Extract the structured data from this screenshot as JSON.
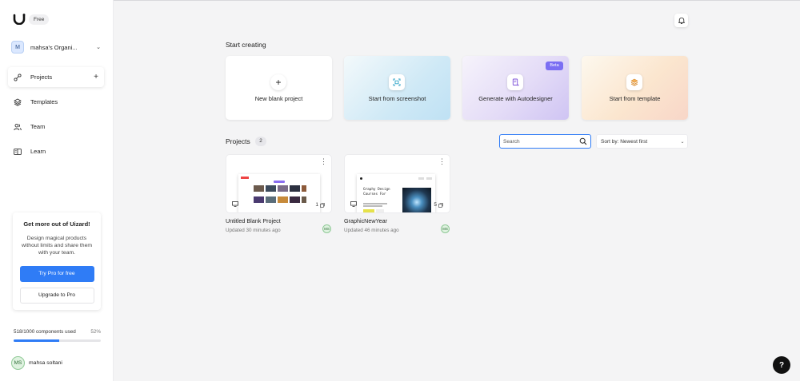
{
  "sidebar": {
    "plan_badge": "Free",
    "org": {
      "initial": "M",
      "name": "mahsa's Organi..."
    },
    "nav": [
      {
        "label": "Projects",
        "icon": "projects-icon"
      },
      {
        "label": "Templates",
        "icon": "layers-icon"
      },
      {
        "label": "Team",
        "icon": "team-icon"
      },
      {
        "label": "Learn",
        "icon": "book-icon"
      }
    ],
    "promo": {
      "title": "Get more out of Uizard!",
      "text": "Design magical products without limits and share them with your team.",
      "primary_button": "Try Pro for free",
      "secondary_button": "Upgrade to Pro"
    },
    "usage": {
      "label": "518/1000 components used",
      "percent_text": "52%",
      "fraction": 0.52
    },
    "user": {
      "initials": "MS",
      "name": "mahsa soltani"
    }
  },
  "main": {
    "start_title": "Start creating",
    "start_cards": [
      {
        "label": "New blank project",
        "icon": "plus-icon"
      },
      {
        "label": "Start from screenshot",
        "icon": "screenshot-scan-icon"
      },
      {
        "label": "Generate with Autodesigner",
        "icon": "autodesigner-icon",
        "badge": "Beta"
      },
      {
        "label": "Start from template",
        "icon": "template-stack-icon"
      }
    ],
    "projects_title": "Projects",
    "projects_count": "2",
    "search_placeholder": "Search",
    "sort_label": "Sort by: Newest first",
    "projects": [
      {
        "name": "Untitled Blank Project",
        "updated": "Updated 30 minutes ago",
        "pages": "1",
        "avatar": "MS"
      },
      {
        "name": "GraphicNewYear",
        "updated": "Updated 46 minutes ago",
        "pages": "5",
        "avatar": "MS",
        "preview_text": "Graphy Design Courses For"
      }
    ]
  },
  "help_label": "?",
  "colors": {
    "accent": "#2f7cf6",
    "beta": "#7b6ef3"
  }
}
